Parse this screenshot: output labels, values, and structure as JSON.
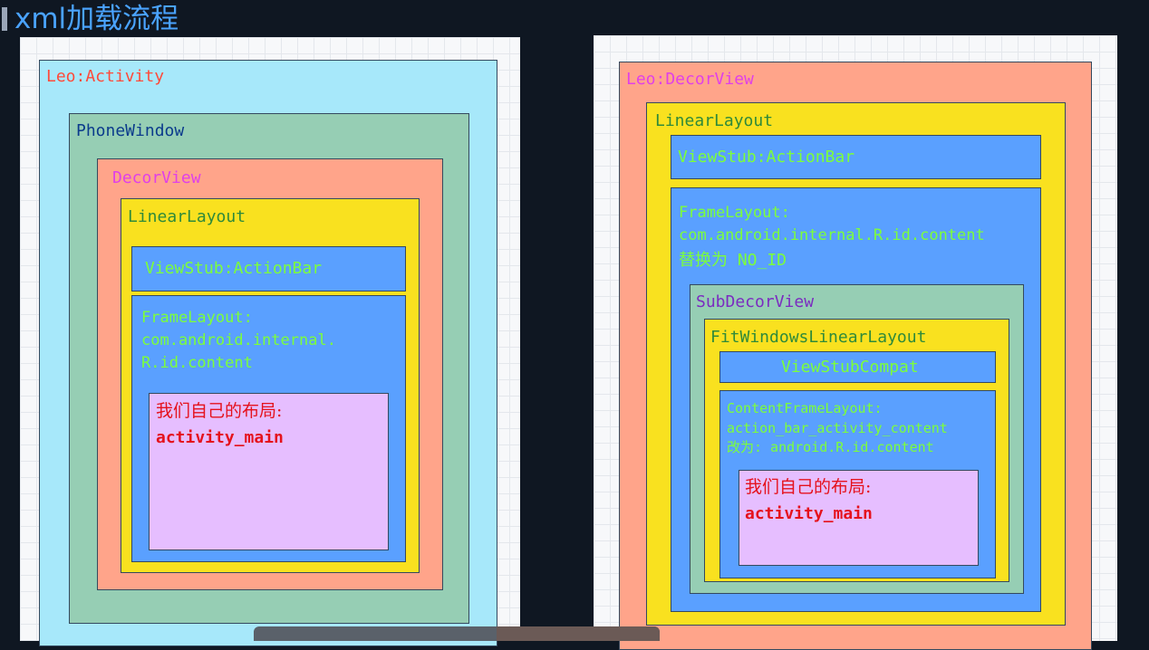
{
  "title": "xml加载流程",
  "left": {
    "activity": "Leo:Activity",
    "phone_window": "PhoneWindow",
    "decor_view": "DecorView",
    "linear_layout": "LinearLayout",
    "view_stub": "ViewStub:ActionBar",
    "frame_layout": [
      "FrameLayout:",
      "com.android.internal.",
      "R.id.content"
    ],
    "own_layout": [
      "我们自己的布局:",
      "activity_main"
    ]
  },
  "right": {
    "decor_view": "Leo:DecorView",
    "linear_layout": "LinearLayout",
    "view_stub": "ViewStub:ActionBar",
    "frame_layout": [
      "FrameLayout:",
      "com.android.internal.R.id.content",
      "替换为 NO_ID"
    ],
    "sub_decor_view": "SubDecorView",
    "fit_windows": "FitWindowsLinearLayout",
    "view_stub_compat": "ViewStubCompat",
    "content_frame": [
      "ContentFrameLayout:",
      "action_bar_activity_content",
      "改为: android.R.id.content"
    ],
    "own_layout": [
      "我们自己的布局:",
      "activity_main"
    ]
  },
  "colors": {
    "activity": "#a7e8fa",
    "phone_window": "#96ceb4",
    "decor_view": "#ffa48a",
    "linear_layout": "#f9e11f",
    "blue": "#5aa0ff",
    "sub_decor": "#96ceb4",
    "own_layout": "#e6beff"
  }
}
